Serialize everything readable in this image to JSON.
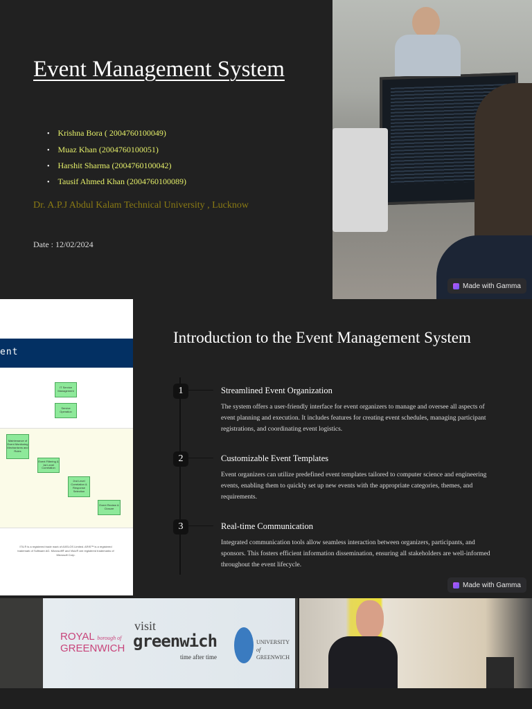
{
  "slide1": {
    "title": "Event Management System ",
    "members": [
      "Krishna Bora ( 2004760100049)",
      "Muaz Khan (2004760100051)",
      "Harshit Sharma (2004760100042)",
      "Tausif Ahmed Khan (2004760100089)"
    ],
    "university": "Dr. A.P.J Abdul Kalam Technical University , Lucknow",
    "date": "Date :  12/02/2024",
    "badge": "Made with Gamma"
  },
  "slide2": {
    "diagram": {
      "banner": "ent",
      "boxes": [
        "IT Service Management",
        "Service Operation",
        "Maintenance of Event Monitoring Mechanisms and Rules",
        "Event Filtering & 1st Level Correlation",
        "2nd Level Correlation & Response Selection",
        "Event Review & Closure"
      ],
      "footer": "ITIL® is a registered trade mark of AXELOS Limited. ARIS™ is a registered trademark of Software AG. Microsoft® and Visio® are registered trademarks of Microsoft Corp."
    },
    "title": "Introduction to the Event Management System",
    "items": [
      {
        "num": "1",
        "heading": "Streamlined Event Organization",
        "body": "The system offers a user-friendly interface for event organizers to manage and oversee all aspects of event planning and execution. It includes features for creating event schedules, managing participant registrations, and coordinating event logistics."
      },
      {
        "num": "2",
        "heading": "Customizable Event Templates",
        "body": "Event organizers can utilize predefined event templates tailored to computer science and engineering events, enabling them to quickly set up new events with the appropriate categories, themes, and requirements."
      },
      {
        "num": "3",
        "heading": "Real-time Communication",
        "body": "Integrated communication tools allow seamless interaction between organizers, participants, and sponsors. This fosters efficient information dissemination, ensuring all stakeholders are well-informed throughout the event lifecycle."
      }
    ],
    "badge": "Made with Gamma"
  },
  "slide3": {
    "logos": [
      "ROYAL",
      "borough of",
      "GREENWICH",
      "visit",
      "greenwich",
      "time after time",
      "UNIVERSITY",
      "of",
      "GREENWICH"
    ]
  }
}
